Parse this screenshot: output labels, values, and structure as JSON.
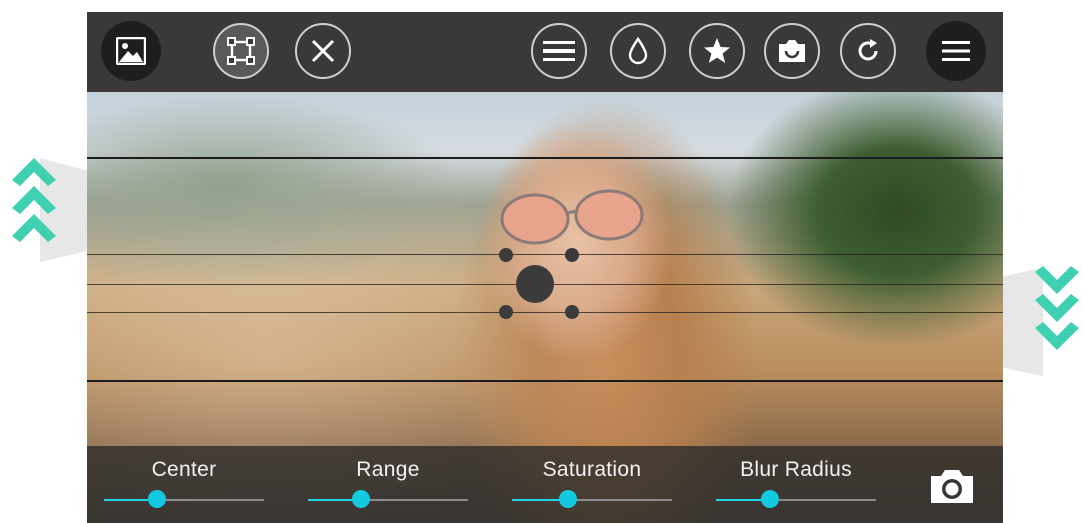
{
  "toolbar": {
    "left_buttons": [
      {
        "icon": "image-icon",
        "style": "filled"
      },
      {
        "icon": "crop-icon",
        "style": "active"
      },
      {
        "icon": "close-icon",
        "style": "outline"
      }
    ],
    "right_buttons": [
      {
        "icon": "linear-blur-icon"
      },
      {
        "icon": "droplet-icon"
      },
      {
        "icon": "star-icon"
      },
      {
        "icon": "selfie-camera-icon"
      },
      {
        "icon": "rotate-icon"
      },
      {
        "icon": "menu-icon",
        "style": "filled"
      }
    ]
  },
  "sliders": [
    {
      "label": "Center",
      "value": 0.33
    },
    {
      "label": "Range",
      "value": 0.33
    },
    {
      "label": "Saturation",
      "value": 0.35
    },
    {
      "label": "Blur Radius",
      "value": 0.34
    }
  ],
  "colors": {
    "accent": "#12c9e0",
    "toolbar_bg": "#3a3937",
    "chevron": "#4fd1b5"
  },
  "camera_button": {
    "icon": "camera-icon"
  }
}
